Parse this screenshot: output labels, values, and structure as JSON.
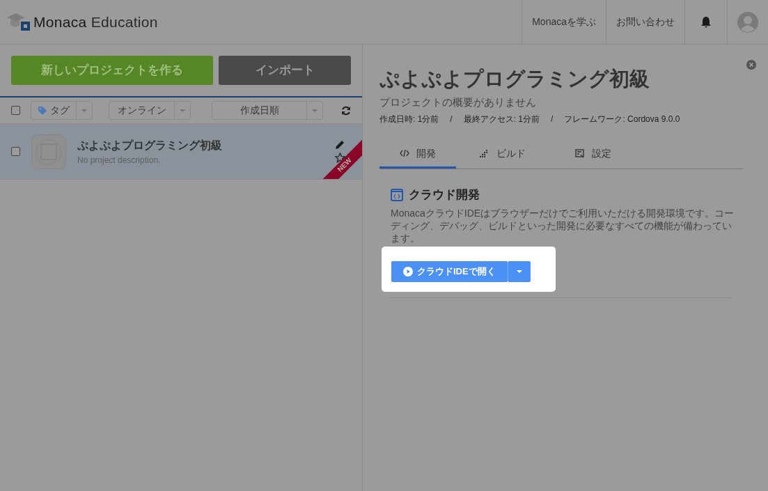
{
  "header": {
    "logo": {
      "brand": "Monaca",
      "product": "Education"
    },
    "nav": [
      "Monacaを学ぶ",
      "お問い合わせ"
    ]
  },
  "actions": {
    "new_project": "新しいプロジェクトを作る",
    "import": "インポート"
  },
  "toolbar": {
    "select_all": {
      "checked": false
    },
    "tag_filter": "タグ",
    "status_filter": "オンライン",
    "sort": "作成日順"
  },
  "projects": [
    {
      "name": "ぷよぷよプログラミング初級",
      "description": "No project description.",
      "checked": false,
      "selected": true,
      "badge": "NEW"
    }
  ],
  "detail": {
    "title": "ぷよぷよプログラミング初級",
    "summary": "プロジェクトの概要がありません",
    "meta": [
      "作成日時: 1分前",
      "/",
      "最終アクセス: 1分前",
      "/",
      "フレームワーク: Cordova 9.0.0"
    ],
    "tabs": [
      {
        "label": "開発",
        "kind": "code",
        "selected": true
      },
      {
        "label": "ビルド",
        "kind": "build",
        "selected": false
      },
      {
        "label": "設定",
        "kind": "settings",
        "selected": false
      }
    ],
    "section": {
      "title": "クラウド開発",
      "description": "MonacaクラウドIDEはブラウザーだけでご利用いただける開発環境です。コーディング、デバッグ、ビルドといった開発に必要なすべての機能が備わっています。",
      "button": "クラウドIDEで開く"
    }
  }
}
